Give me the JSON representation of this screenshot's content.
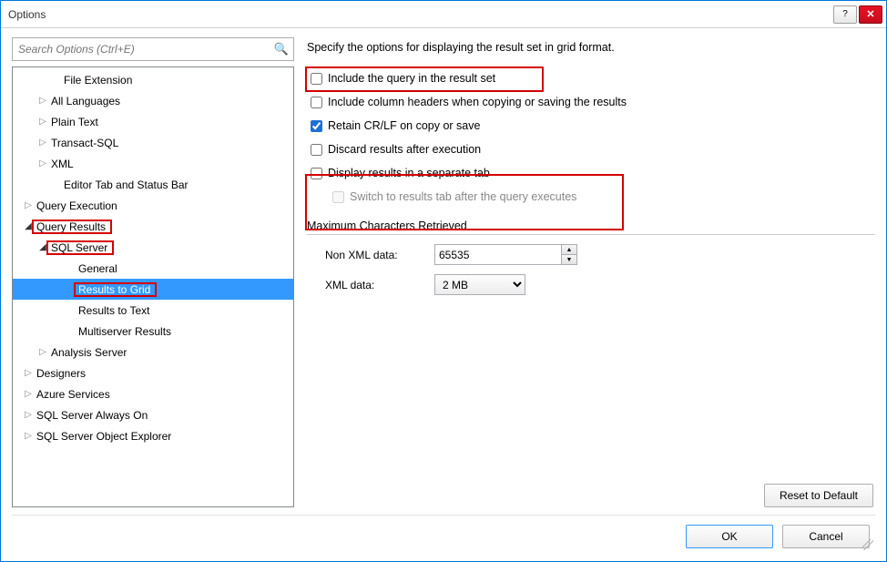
{
  "window": {
    "title": "Options"
  },
  "search": {
    "placeholder": "Search Options (Ctrl+E)"
  },
  "tree": {
    "items": [
      {
        "label": "File Extension",
        "indent": 40,
        "arrow": ""
      },
      {
        "label": "All Languages",
        "indent": 26,
        "arrow": "▷"
      },
      {
        "label": "Plain Text",
        "indent": 26,
        "arrow": "▷"
      },
      {
        "label": "Transact-SQL",
        "indent": 26,
        "arrow": "▷"
      },
      {
        "label": "XML",
        "indent": 26,
        "arrow": "▷"
      },
      {
        "label": "Editor Tab and Status Bar",
        "indent": 40,
        "arrow": ""
      },
      {
        "label": "Query Execution",
        "indent": 10,
        "arrow": "▷"
      },
      {
        "label": "Query Results",
        "indent": 10,
        "arrow": "◢",
        "hl": true
      },
      {
        "label": "SQL Server",
        "indent": 26,
        "arrow": "◢",
        "hl": true
      },
      {
        "label": "General",
        "indent": 56,
        "arrow": ""
      },
      {
        "label": "Results to Grid",
        "indent": 56,
        "arrow": "",
        "selected": true,
        "hl": true
      },
      {
        "label": "Results to Text",
        "indent": 56,
        "arrow": ""
      },
      {
        "label": "Multiserver Results",
        "indent": 56,
        "arrow": ""
      },
      {
        "label": "Analysis Server",
        "indent": 26,
        "arrow": "▷"
      },
      {
        "label": "Designers",
        "indent": 10,
        "arrow": "▷"
      },
      {
        "label": "Azure Services",
        "indent": 10,
        "arrow": "▷"
      },
      {
        "label": "SQL Server Always On",
        "indent": 10,
        "arrow": "▷"
      },
      {
        "label": "SQL Server Object Explorer",
        "indent": 10,
        "arrow": "▷"
      }
    ]
  },
  "right": {
    "desc": "Specify the options for displaying the result set in grid format.",
    "opts": [
      {
        "label": "Include the query in the result set",
        "checked": false,
        "hl": true
      },
      {
        "label": "Include column headers when copying or saving the results",
        "checked": false
      },
      {
        "label": "Retain CR/LF on copy or save",
        "checked": true
      },
      {
        "label": "Discard results after execution",
        "checked": false
      },
      {
        "label": "Display results in a separate tab",
        "checked": false,
        "hl_group": true
      },
      {
        "label": "Switch to results tab after the query executes",
        "checked": false,
        "disabled": true,
        "indent": true
      }
    ],
    "group": {
      "legend": "Maximum Characters Retrieved",
      "nonxml_label": "Non XML data:",
      "nonxml_value": "65535",
      "xml_label": "XML data:",
      "xml_value": "2 MB"
    },
    "reset": "Reset to Default"
  },
  "footer": {
    "ok": "OK",
    "cancel": "Cancel"
  }
}
